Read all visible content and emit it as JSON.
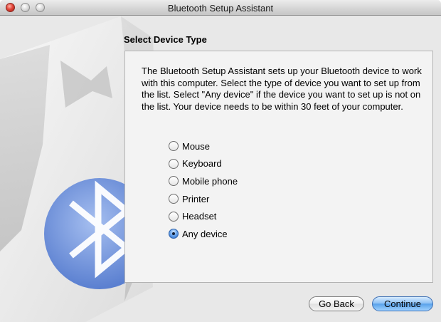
{
  "window": {
    "title": "Bluetooth Setup Assistant"
  },
  "page": {
    "heading": "Select Device Type",
    "description": "The Bluetooth Setup Assistant sets up your Bluetooth device to work with this computer. Select the type of device you want to set up from the list. Select \"Any device\" if the device you want to set up is not on the list. Your device needs to be within 30 feet of your computer."
  },
  "device_types": {
    "selected": "Any device",
    "options": [
      {
        "label": "Mouse",
        "checked": false
      },
      {
        "label": "Keyboard",
        "checked": false
      },
      {
        "label": "Mobile phone",
        "checked": false
      },
      {
        "label": "Printer",
        "checked": false
      },
      {
        "label": "Headset",
        "checked": false
      },
      {
        "label": "Any device",
        "checked": true
      }
    ]
  },
  "buttons": {
    "back": "Go Back",
    "continue": "Continue"
  },
  "colors": {
    "accent": "#5aa2ea",
    "bluetooth_badge": "#6f8fd8"
  }
}
